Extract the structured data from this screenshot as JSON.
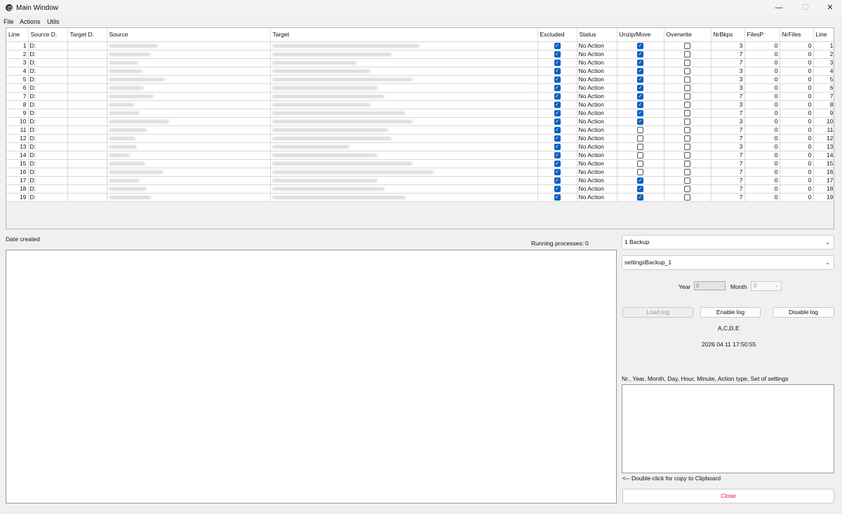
{
  "window": {
    "title": "Main Window",
    "minimize": "—",
    "maximize": "☐",
    "close": "✕"
  },
  "menu": [
    "File",
    "Actions",
    "Utils"
  ],
  "table": {
    "columns": [
      "Line",
      "Source D.",
      "Target D.",
      "Source",
      "Target",
      "Excluded",
      "Status",
      "Unzip/Move",
      "Overwrite",
      "NrBkps",
      "FilesP",
      "NrFiles",
      "Line"
    ],
    "rows": [
      {
        "line": "1",
        "source_drive": "D:",
        "excluded": true,
        "status": "No Action",
        "unzip": true,
        "overwrite": false,
        "nrbkps": "3",
        "filesp": "0",
        "nrfiles": "0"
      },
      {
        "line": "2",
        "source_drive": "D:",
        "excluded": true,
        "status": "No Action",
        "unzip": true,
        "overwrite": false,
        "nrbkps": "7",
        "filesp": "0",
        "nrfiles": "0"
      },
      {
        "line": "3",
        "source_drive": "D:",
        "excluded": true,
        "status": "No Action",
        "unzip": true,
        "overwrite": false,
        "nrbkps": "7",
        "filesp": "0",
        "nrfiles": "0"
      },
      {
        "line": "4",
        "source_drive": "D:",
        "excluded": true,
        "status": "No Action",
        "unzip": true,
        "overwrite": false,
        "nrbkps": "3",
        "filesp": "0",
        "nrfiles": "0"
      },
      {
        "line": "5",
        "source_drive": "D:",
        "excluded": true,
        "status": "No Action",
        "unzip": true,
        "overwrite": false,
        "nrbkps": "3",
        "filesp": "0",
        "nrfiles": "0"
      },
      {
        "line": "6",
        "source_drive": "D:",
        "excluded": true,
        "status": "No Action",
        "unzip": true,
        "overwrite": false,
        "nrbkps": "3",
        "filesp": "0",
        "nrfiles": "0"
      },
      {
        "line": "7",
        "source_drive": "D:",
        "excluded": true,
        "status": "No Action",
        "unzip": true,
        "overwrite": false,
        "nrbkps": "7",
        "filesp": "0",
        "nrfiles": "0"
      },
      {
        "line": "8",
        "source_drive": "D:",
        "excluded": true,
        "status": "No Action",
        "unzip": true,
        "overwrite": false,
        "nrbkps": "3",
        "filesp": "0",
        "nrfiles": "0"
      },
      {
        "line": "9",
        "source_drive": "D:",
        "excluded": true,
        "status": "No Action",
        "unzip": true,
        "overwrite": false,
        "nrbkps": "7",
        "filesp": "0",
        "nrfiles": "0"
      },
      {
        "line": "10",
        "source_drive": "D:",
        "excluded": true,
        "status": "No Action",
        "unzip": true,
        "overwrite": false,
        "nrbkps": "3",
        "filesp": "0",
        "nrfiles": "0"
      },
      {
        "line": "11",
        "source_drive": "D:",
        "excluded": true,
        "status": "No Action",
        "unzip": false,
        "overwrite": false,
        "nrbkps": "7",
        "filesp": "0",
        "nrfiles": "0"
      },
      {
        "line": "12",
        "source_drive": "D:",
        "excluded": true,
        "status": "No Action",
        "unzip": false,
        "overwrite": false,
        "nrbkps": "7",
        "filesp": "0",
        "nrfiles": "0"
      },
      {
        "line": "13",
        "source_drive": "D:",
        "excluded": true,
        "status": "No Action",
        "unzip": false,
        "overwrite": false,
        "nrbkps": "3",
        "filesp": "0",
        "nrfiles": "0"
      },
      {
        "line": "14",
        "source_drive": "D:",
        "excluded": true,
        "status": "No Action",
        "unzip": false,
        "overwrite": false,
        "nrbkps": "7",
        "filesp": "0",
        "nrfiles": "0"
      },
      {
        "line": "15",
        "source_drive": "D:",
        "excluded": true,
        "status": "No Action",
        "unzip": false,
        "overwrite": false,
        "nrbkps": "7",
        "filesp": "0",
        "nrfiles": "0"
      },
      {
        "line": "16",
        "source_drive": "D:",
        "excluded": true,
        "status": "No Action",
        "unzip": false,
        "overwrite": false,
        "nrbkps": "7",
        "filesp": "0",
        "nrfiles": "0"
      },
      {
        "line": "17",
        "source_drive": "D:",
        "excluded": true,
        "status": "No Action",
        "unzip": true,
        "overwrite": false,
        "nrbkps": "7",
        "filesp": "0",
        "nrfiles": "0"
      },
      {
        "line": "18",
        "source_drive": "D:",
        "excluded": true,
        "status": "No Action",
        "unzip": true,
        "overwrite": false,
        "nrbkps": "7",
        "filesp": "0",
        "nrfiles": "0"
      },
      {
        "line": "19",
        "source_drive": "D:",
        "excluded": true,
        "status": "No Action",
        "unzip": true,
        "overwrite": false,
        "nrbkps": "7",
        "filesp": "0",
        "nrfiles": "0"
      }
    ]
  },
  "log": {
    "date_label": "Date created",
    "running_label": "Running processes:",
    "running_count": "0"
  },
  "right_panel": {
    "backup_select": "1 Backup",
    "settings_select": "settingsBackup_1",
    "year_label": "Year",
    "year_value": "0",
    "month_label": "Month",
    "month_value": "0",
    "load_log": "Load log",
    "enable_log": "Enable log",
    "disable_log": "Disable log",
    "drives": "A,C,D,E",
    "datetime": "2026 04 11 17:50:55",
    "schedule_header": "Nr., Year, Month, Day, Hour, Minute, Action type, Set of settings",
    "clipboard_hint": "<-- Double-click for copy to Clipboard",
    "close": "Close"
  },
  "colors": {
    "checkbox_checked": "#0a5fc4",
    "close_text": "#e8104e",
    "window_bg": "#f0f0f0"
  }
}
